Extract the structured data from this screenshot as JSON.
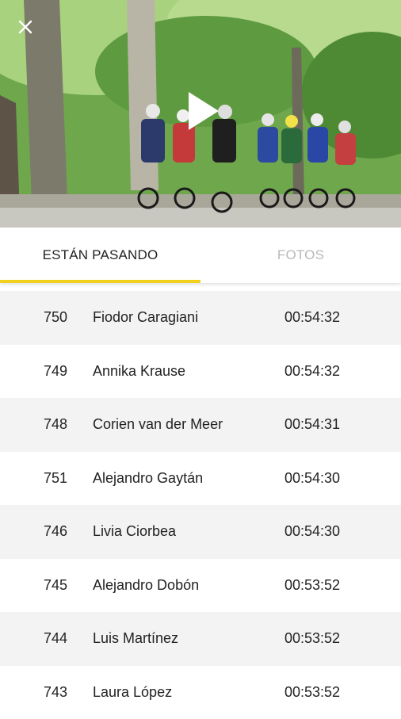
{
  "video": {
    "close_icon": "close-icon",
    "play_icon": "play-icon"
  },
  "tabs": [
    {
      "label": "ESTÁN PASANDO",
      "active": true
    },
    {
      "label": "FOTOS",
      "active": false
    }
  ],
  "colors": {
    "accent": "#f2d01e",
    "row_alt": "#f3f3f3",
    "inactive_tab": "#b9b9b9"
  },
  "passing": [
    {
      "bib": "750",
      "name": "Fiodor Caragiani",
      "time": "00:54:32"
    },
    {
      "bib": "749",
      "name": "Annika Krause",
      "time": "00:54:32"
    },
    {
      "bib": "748",
      "name": "Corien van der Meer",
      "time": "00:54:31"
    },
    {
      "bib": "751",
      "name": "Alejandro Gaytán",
      "time": "00:54:30"
    },
    {
      "bib": "746",
      "name": "Livia Ciorbea",
      "time": "00:54:30"
    },
    {
      "bib": "745",
      "name": "Alejandro Dobón",
      "time": "00:53:52"
    },
    {
      "bib": "744",
      "name": "Luis Martínez",
      "time": "00:53:52"
    },
    {
      "bib": "743",
      "name": "Laura López",
      "time": "00:53:52"
    }
  ]
}
